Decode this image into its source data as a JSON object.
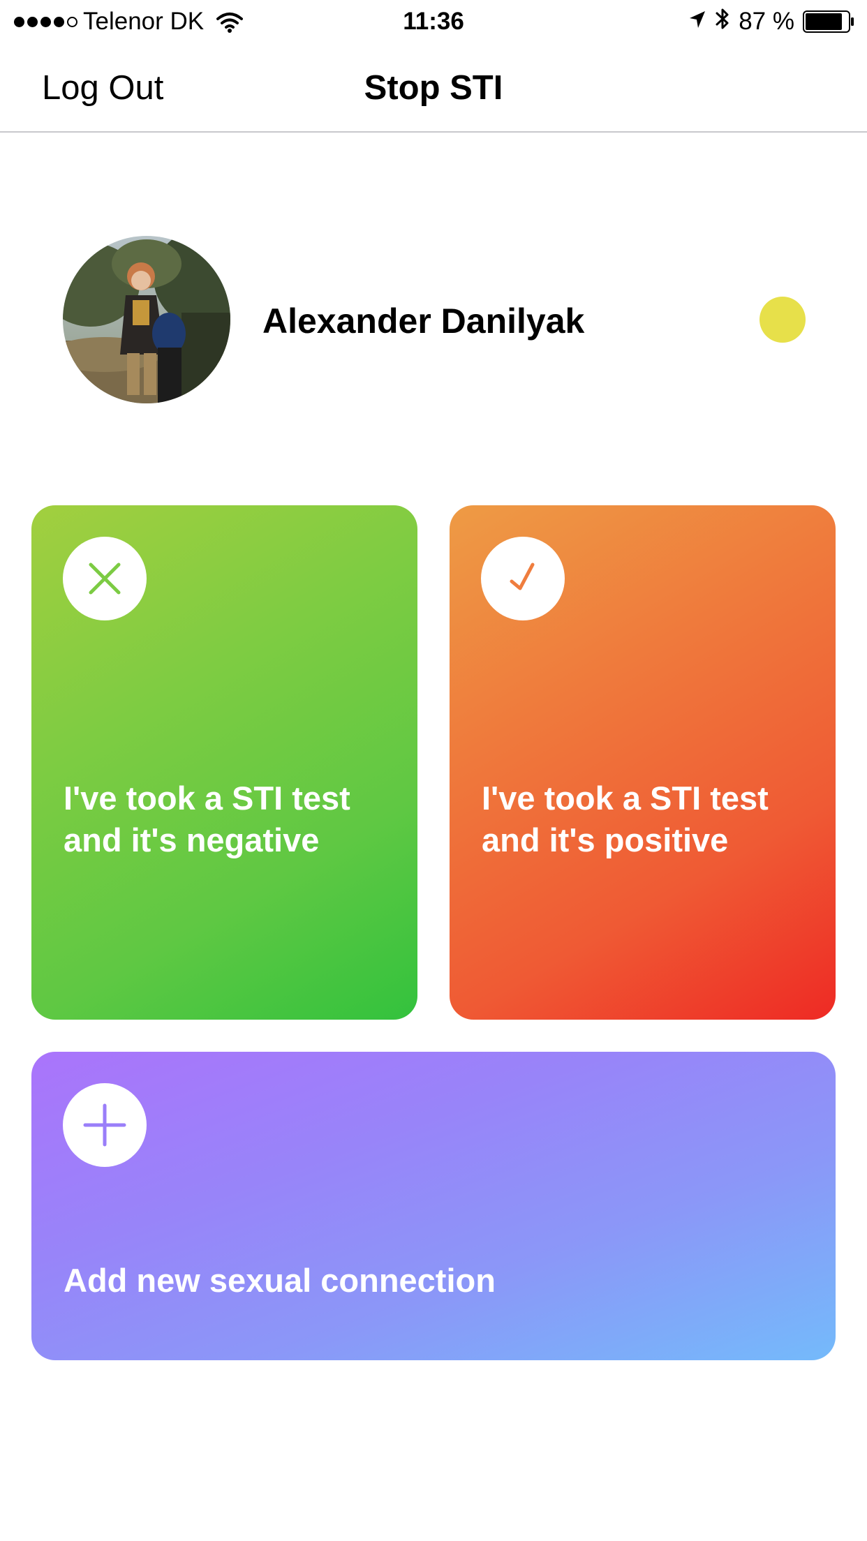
{
  "status_bar": {
    "carrier": "Telenor DK",
    "time": "11:36",
    "battery_percent": "87 %",
    "battery_level": 0.87,
    "signal_bars_filled": 4,
    "signal_bars_total": 5
  },
  "nav": {
    "logout_label": "Log Out",
    "title": "Stop STI"
  },
  "profile": {
    "name": "Alexander Danilyak",
    "status_color": "#e7e04a"
  },
  "cards": {
    "negative": {
      "text": "I've took a STI test\nand it's negative",
      "icon": "x-icon",
      "icon_color": "#7ccb43"
    },
    "positive": {
      "text": "I've took a STI test\nand it's positive",
      "icon": "check-icon",
      "icon_color": "#ef7d3e"
    },
    "add": {
      "text": "Add new sexual connection",
      "icon": "plus-icon",
      "icon_color": "#9a7ef9"
    }
  }
}
